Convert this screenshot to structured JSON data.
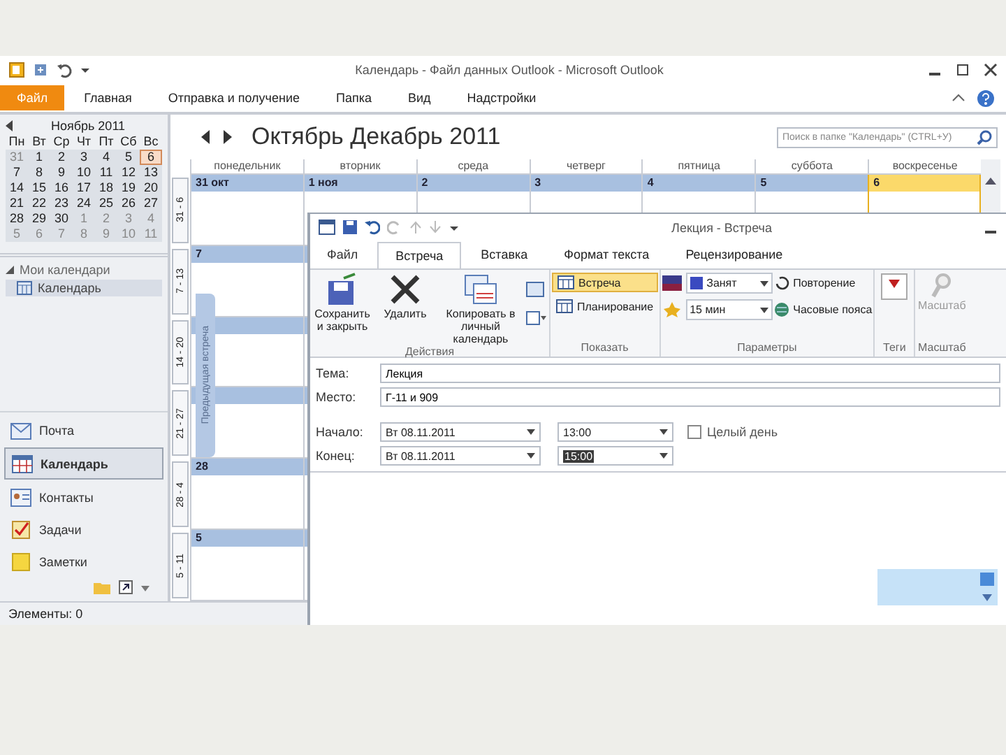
{
  "window": {
    "title": "Календарь - Файл данных Outlook - Microsoft Outlook"
  },
  "ribbon_tabs": [
    {
      "label": "Файл",
      "selected": true,
      "kind": "file"
    },
    {
      "label": "Главная",
      "selected": false,
      "kind": "tab"
    },
    {
      "label": "Отправка и получение",
      "selected": false,
      "kind": "tab"
    },
    {
      "label": "Папка",
      "selected": false,
      "kind": "tab"
    },
    {
      "label": "Вид",
      "selected": false,
      "kind": "tab"
    },
    {
      "label": "Надстройки",
      "selected": false,
      "kind": "tab"
    }
  ],
  "mini_calendar": {
    "month": "Ноябрь 2011",
    "weekdays": [
      "Пн",
      "Вт",
      "Ср",
      "Чт",
      "Пт",
      "Сб",
      "Вс"
    ],
    "weeks": [
      [
        {
          "d": "31",
          "muted": true,
          "selected": false
        },
        {
          "d": "1",
          "muted": false,
          "selected": false
        },
        {
          "d": "2",
          "muted": false,
          "selected": false
        },
        {
          "d": "3",
          "muted": false,
          "selected": false
        },
        {
          "d": "4",
          "muted": false,
          "selected": false
        },
        {
          "d": "5",
          "muted": false,
          "selected": false
        },
        {
          "d": "6",
          "muted": false,
          "selected": true
        }
      ],
      [
        {
          "d": "7",
          "muted": false,
          "selected": false
        },
        {
          "d": "8",
          "muted": false,
          "selected": false
        },
        {
          "d": "9",
          "muted": false,
          "selected": false
        },
        {
          "d": "10",
          "muted": false,
          "selected": false
        },
        {
          "d": "11",
          "muted": false,
          "selected": false
        },
        {
          "d": "12",
          "muted": false,
          "selected": false
        },
        {
          "d": "13",
          "muted": false,
          "selected": false
        }
      ],
      [
        {
          "d": "14",
          "muted": false,
          "selected": false
        },
        {
          "d": "15",
          "muted": false,
          "selected": false
        },
        {
          "d": "16",
          "muted": false,
          "selected": false
        },
        {
          "d": "17",
          "muted": false,
          "selected": false
        },
        {
          "d": "18",
          "muted": false,
          "selected": false
        },
        {
          "d": "19",
          "muted": false,
          "selected": false
        },
        {
          "d": "20",
          "muted": false,
          "selected": false
        }
      ],
      [
        {
          "d": "21",
          "muted": false,
          "selected": false
        },
        {
          "d": "22",
          "muted": false,
          "selected": false
        },
        {
          "d": "23",
          "muted": false,
          "selected": false
        },
        {
          "d": "24",
          "muted": false,
          "selected": false
        },
        {
          "d": "25",
          "muted": false,
          "selected": false
        },
        {
          "d": "26",
          "muted": false,
          "selected": false
        },
        {
          "d": "27",
          "muted": false,
          "selected": false
        }
      ],
      [
        {
          "d": "28",
          "muted": false,
          "selected": false
        },
        {
          "d": "29",
          "muted": false,
          "selected": false
        },
        {
          "d": "30",
          "muted": false,
          "selected": false
        },
        {
          "d": "1",
          "muted": true,
          "selected": false
        },
        {
          "d": "2",
          "muted": true,
          "selected": false
        },
        {
          "d": "3",
          "muted": true,
          "selected": false
        },
        {
          "d": "4",
          "muted": true,
          "selected": false
        }
      ],
      [
        {
          "d": "5",
          "muted": true,
          "selected": false
        },
        {
          "d": "6",
          "muted": true,
          "selected": false
        },
        {
          "d": "7",
          "muted": true,
          "selected": false
        },
        {
          "d": "8",
          "muted": true,
          "selected": false
        },
        {
          "d": "9",
          "muted": true,
          "selected": false
        },
        {
          "d": "10",
          "muted": true,
          "selected": false
        },
        {
          "d": "11",
          "muted": true,
          "selected": false
        }
      ]
    ]
  },
  "calendars": {
    "heading": "Мои календари",
    "expanded": true,
    "items": [
      {
        "label": "Календарь",
        "selected": true
      }
    ]
  },
  "nav": [
    {
      "label": "Почта",
      "kind": "mail",
      "selected": false
    },
    {
      "label": "Календарь",
      "kind": "calendar",
      "selected": true
    },
    {
      "label": "Контакты",
      "kind": "contacts",
      "selected": false
    },
    {
      "label": "Задачи",
      "kind": "tasks",
      "selected": false
    },
    {
      "label": "Заметки",
      "kind": "notes",
      "selected": false
    }
  ],
  "status_bar": "Элементы: 0",
  "calendar": {
    "range": "Октябрь   Декабрь 2011",
    "search": {
      "placeholder": "Поиск в папке \"Календарь\" (CTRL+У)"
    },
    "day_headers": [
      "понедельник",
      "вторник",
      "среда",
      "четверг",
      "пятница",
      "суббота",
      "воскресенье"
    ],
    "weeks": [
      {
        "label": "31 - 6",
        "days": [
          {
            "date": "31 окт",
            "today": false
          },
          {
            "date": "1 ноя",
            "today": false
          },
          {
            "date": "2",
            "today": false
          },
          {
            "date": "3",
            "today": false
          },
          {
            "date": "4",
            "today": false
          },
          {
            "date": "5",
            "today": false
          },
          {
            "date": "6",
            "today": true
          }
        ]
      },
      {
        "label": "7 - 13",
        "days": [
          {
            "date": "7",
            "today": false
          }
        ]
      },
      {
        "label": "14 - 20"
      },
      {
        "label": "21 - 27"
      },
      {
        "label": "28 - 4",
        "days": [
          {
            "date": "28",
            "today": false
          }
        ]
      },
      {
        "label": "5 - 11",
        "days": [
          {
            "date": "5",
            "today": false
          }
        ]
      }
    ],
    "side_tab": "Предыдущая встреча"
  },
  "appointment": {
    "title": "Лекция - Встреча",
    "tabs": [
      {
        "label": "Файл",
        "selected": false,
        "kind": "file"
      },
      {
        "label": "Встреча",
        "selected": true,
        "kind": "tab"
      },
      {
        "label": "Вставка",
        "selected": false,
        "kind": "tab"
      },
      {
        "label": "Формат текста",
        "selected": false,
        "kind": "tab"
      },
      {
        "label": "Рецензирование",
        "selected": false,
        "kind": "tab"
      }
    ],
    "groups": {
      "actions": {
        "label": "Действия",
        "save": "Сохранить и закрыть",
        "delete": "Удалить",
        "copy": "Копировать в личный календарь"
      },
      "show": {
        "label": "Показать",
        "items": [
          {
            "label": "Встреча",
            "selected": true
          },
          {
            "label": "Планирование",
            "selected": false
          }
        ]
      },
      "options": {
        "label": "Параметры",
        "show_as": "Занят",
        "reminder": "15 мин",
        "recurrence": "Повторение",
        "time_zones": "Часовые пояса"
      },
      "tags": {
        "label": "Теги"
      },
      "zoom": {
        "label": "Масштаб",
        "button": "Масштаб"
      }
    },
    "fields": {
      "subject_label": "Тема:",
      "subject": "Лекция",
      "location_label": "Место:",
      "location": "Г-11 и 909",
      "start_label": "Начало:",
      "start_date": "Вт 08.11.2011",
      "start_time": "13:00",
      "end_label": "Конец:",
      "end_date": "Вт 08.11.2011",
      "end_time": "15:00",
      "all_day": {
        "label": "Целый день",
        "checked": false
      }
    }
  }
}
